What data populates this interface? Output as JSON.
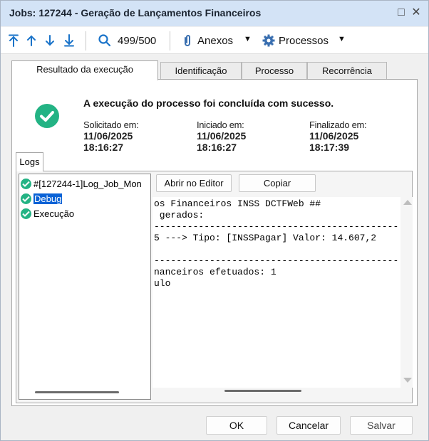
{
  "window": {
    "title": "Jobs: 127244 - Geração de Lançamentos Financeiros",
    "restore_glyph": "□",
    "close_glyph": "✕"
  },
  "toolbar": {
    "counter": "499/500",
    "attachments_label": "Anexos",
    "processes_label": "Processos",
    "icons": [
      "first-icon",
      "up-icon",
      "down-icon",
      "last-icon",
      "search-icon",
      "paperclip-icon",
      "gear-icon"
    ]
  },
  "tabs": [
    {
      "label": "Resultado da execução",
      "active": true
    },
    {
      "label": "Identificação",
      "active": false
    },
    {
      "label": "Processo",
      "active": false
    },
    {
      "label": "Recorrência",
      "active": false
    }
  ],
  "result": {
    "message": "A execução do processo foi concluída com sucesso.",
    "requested_label": "Solicitado em:",
    "requested_date": "11/06/2025",
    "requested_time": "18:16:27",
    "started_label": "Iniciado em:",
    "started_date": "11/06/2025",
    "started_time": "18:16:27",
    "finished_label": "Finalizado em:",
    "finished_date": "11/06/2025",
    "finished_time": "18:17:39"
  },
  "logs": {
    "tab_label": "Logs",
    "items": [
      {
        "label": "#[127244-1]Log_Job_Mon",
        "selected": false
      },
      {
        "label": "Debug",
        "selected": true
      },
      {
        "label": "Execução",
        "selected": false
      }
    ],
    "open_editor_label": "Abrir no Editor",
    "copy_label": "Copiar",
    "content_lines": [
      "os Financeiros INSS DCTFWeb ##",
      " gerados:",
      "--------------------------------------------",
      "5 ---> Tipo: [INSSPagar] Valor: 14.607,2",
      "",
      "--------------------------------------------",
      "nanceiros efetuados: 1",
      "ulo"
    ]
  },
  "footer": {
    "ok_label": "OK",
    "cancel_label": "Cancelar",
    "save_label": "Salvar"
  },
  "colors": {
    "titlebar": "#d3e3f6",
    "success": "#23b384",
    "toolbar_icon": "#1a73c9",
    "selection": "#0a62d6"
  }
}
